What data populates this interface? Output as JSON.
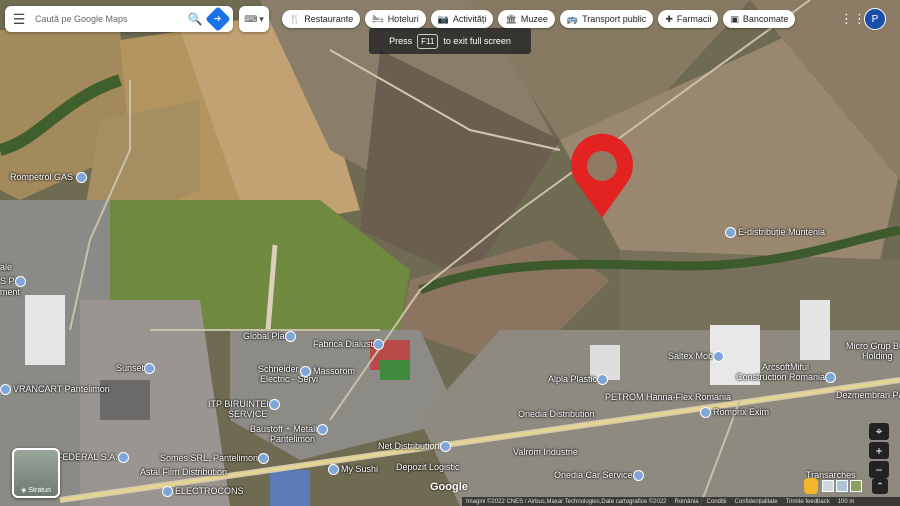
{
  "search": {
    "placeholder": "Caută pe Google Maps"
  },
  "categories": [
    {
      "icon": "restaurant-icon",
      "glyph": "🍴",
      "label": "Restaurante"
    },
    {
      "icon": "hotel-icon",
      "glyph": "🛏",
      "label": "Hoteluri"
    },
    {
      "icon": "camera-icon",
      "glyph": "📷",
      "label": "Activități"
    },
    {
      "icon": "museum-icon",
      "glyph": "🏛",
      "label": "Muzee"
    },
    {
      "icon": "bus-icon",
      "glyph": "🚌",
      "label": "Transport public"
    },
    {
      "icon": "pharmacy-icon",
      "glyph": "✚",
      "label": "Farmacii"
    },
    {
      "icon": "atm-icon",
      "glyph": "▣",
      "label": "Bancomate"
    }
  ],
  "fullscreen_toast": {
    "press": "Press",
    "key": "F11",
    "rest": "to exit full screen"
  },
  "account": {
    "initial": "P"
  },
  "map_labels": {
    "rompetrol": "Rompetrol GAS",
    "e_distributie": "E-distribuție Muntenia",
    "global": "Global Pla",
    "fabrica": "Fabrica Dialust",
    "schneider": "Schneider",
    "electric": "Electric - Servi",
    "massorom": "Massorom",
    "sunset": "Sunset",
    "vranc": "VRANCART Pantelimon",
    "itp1": "ITP BIRUINTEI",
    "itp2": "SERVICE",
    "baustoff1": "Baustoff + Metall",
    "baustoff2": "Pantelimon",
    "net": "Net Distribution",
    "onedia": "Onedia Distribution",
    "alpla": "Alpla Plastic",
    "petrom": "PETROM Hanna-Flex Romania",
    "saltex": "Saltex Mob",
    "arcsoft1": "ArcsoftMiful",
    "arcsoft2": "Construction Romania",
    "micro1": "Micro Grup Bu",
    "micro2": "Holding",
    "dezmem": "Dezmembrari Pa",
    "romprix": "Romprix Exim",
    "valrom": "Valrom Industrie",
    "depozit": "Depozit Logistic",
    "onedia2": "Onedia Car Service",
    "mysushi": "My Sushi",
    "somes": "Somes SRL, Pantelimon",
    "astal": "Astal Film Distribution",
    "electrocons": "ELECTROCONS",
    "federal": "FEDERAL S.A.",
    "trans": "Transarches",
    "ale": "ale",
    "spn": "S P",
    "ment": "ment"
  },
  "layers_label": "Straturi",
  "google": "Google",
  "footer": {
    "imagery": "Imagini ©2022 CNES / Airbus,Maxar Technologies,Date cartografice ©2022",
    "country": "România",
    "terms": "Condiții",
    "privacy": "Confidențialitate",
    "feedback": "Trimite feedback",
    "scale": "100 m"
  }
}
